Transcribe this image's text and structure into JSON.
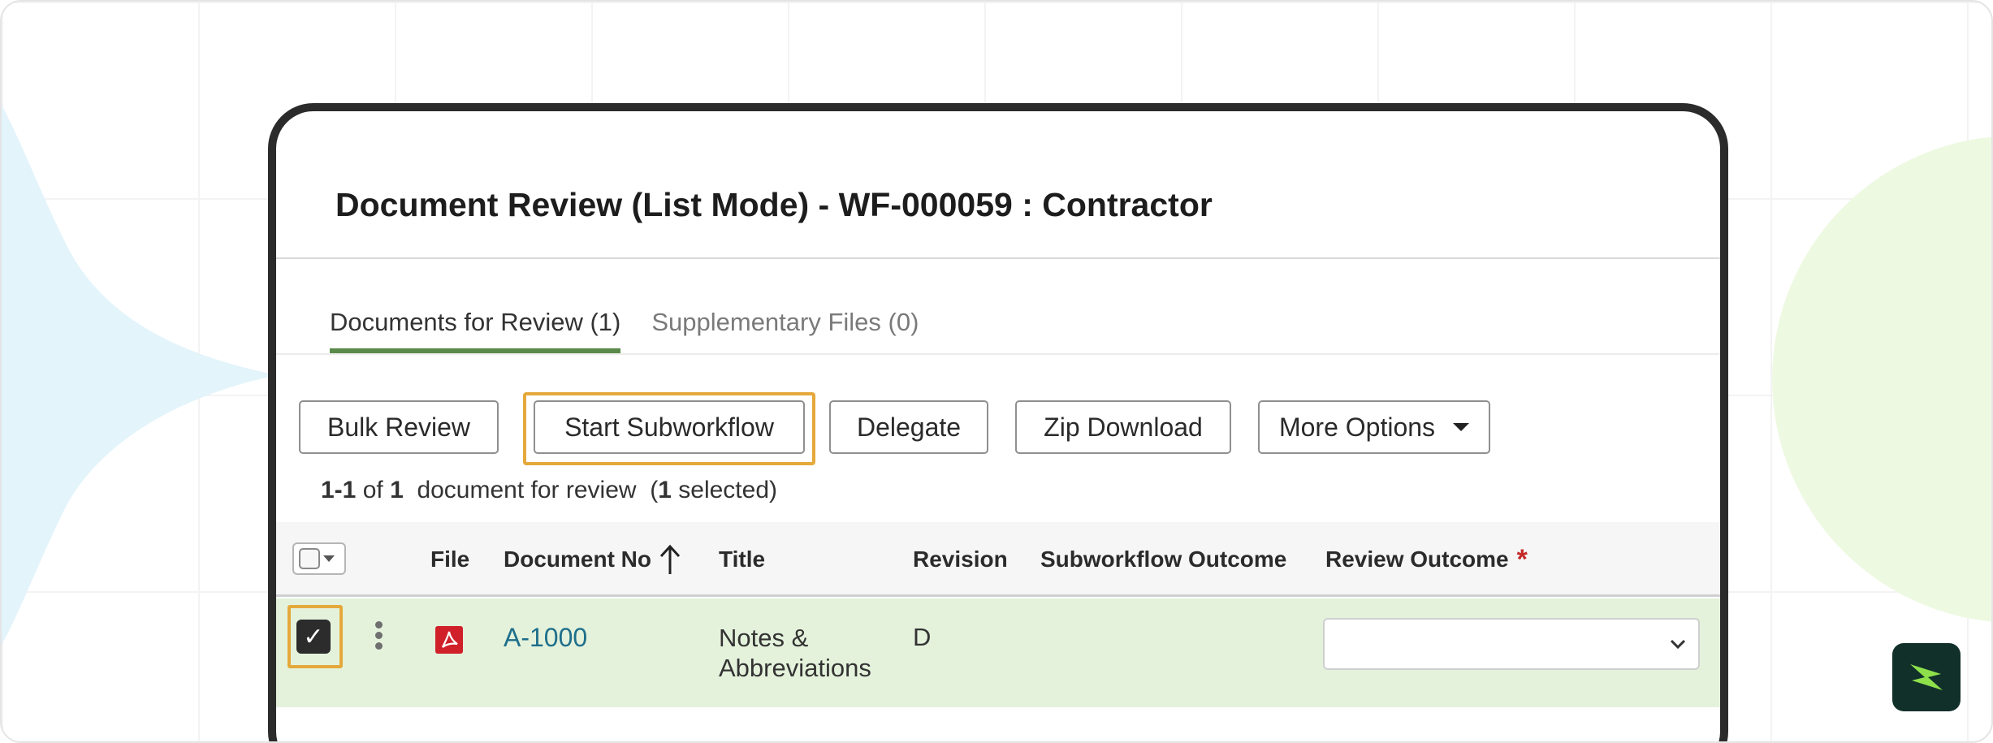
{
  "page": {
    "title": "Document Review (List Mode) - WF-000059 : Contractor"
  },
  "tabs": [
    {
      "label": "Documents for Review (1)",
      "active": true
    },
    {
      "label": "Supplementary Files (0)",
      "active": false
    }
  ],
  "toolbar": {
    "bulk_review": "Bulk Review",
    "start_subworkflow": "Start Subworkflow",
    "delegate": "Delegate",
    "zip_download": "Zip Download",
    "more_options": "More Options"
  },
  "summary": {
    "range": "1-1",
    "of": "of",
    "total": "1",
    "text": "document for review",
    "open_paren": "(",
    "selected_count": "1",
    "selected_text": "selected)"
  },
  "table": {
    "columns": {
      "file": "File",
      "document_no": "Document No",
      "title": "Title",
      "revision": "Revision",
      "subworkflow_outcome": "Subworkflow Outcome",
      "review_outcome": "Review Outcome",
      "required_marker": "*"
    },
    "rows": [
      {
        "checked": true,
        "checkmark": "✓",
        "file_icon": "pdf-icon",
        "document_no": "A-1000",
        "title": "Notes & Abbreviations",
        "revision": "D",
        "subworkflow_outcome": "",
        "review_outcome": ""
      }
    ]
  },
  "colors": {
    "accent_tab": "#5a8a4a",
    "highlight": "#e5a93b",
    "row_selected": "#e4f2dc",
    "link": "#1f6f8b",
    "required": "#c62828",
    "logo_bg": "#11302a",
    "logo_mark": "#8ee04b"
  }
}
